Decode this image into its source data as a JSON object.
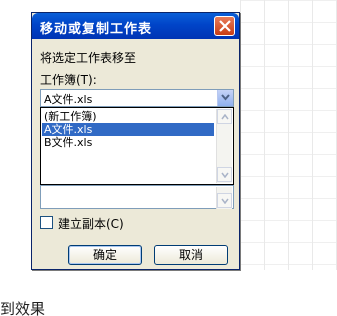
{
  "dialog": {
    "title": "移动或复制工作表",
    "move_to_label": "将选定工作表移至",
    "workbook_label": "工作簿(T):",
    "workbook_value": "A文件.xls",
    "workbook_options": [
      "(新工作簿)",
      "A文件.xls",
      "B文件.xls"
    ],
    "selected_index": 1,
    "create_copy_label": "建立副本(C)",
    "create_copy_checked": false,
    "ok_label": "确定",
    "cancel_label": "取消"
  },
  "background": {
    "text": "到效果"
  },
  "colors": {
    "titlebar": "#0044c8",
    "selection": "#316ac5",
    "dialog_bg": "#ece9d8",
    "close_button": "#c93d14"
  },
  "icons": {
    "close": "close-icon",
    "combo_arrow": "chevron-down-icon",
    "scroll_up": "chevron-up-icon",
    "scroll_down": "chevron-down-icon"
  }
}
